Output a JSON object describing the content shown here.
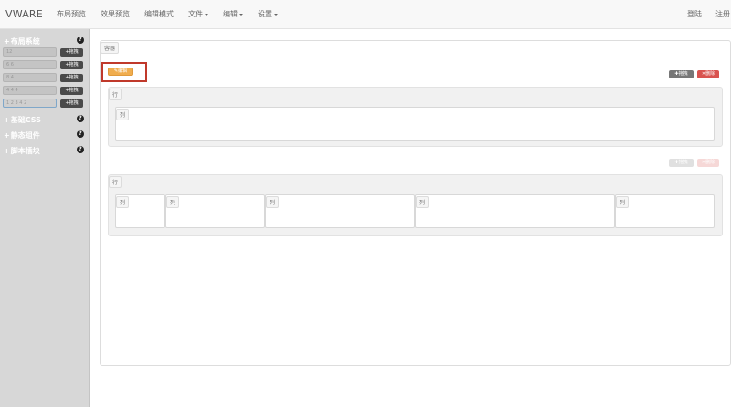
{
  "navbar": {
    "brand": "VWARE",
    "items": [
      "布局预览",
      "效果预览",
      "编辑模式",
      "文件",
      "编辑",
      "设置"
    ],
    "login": "登陆",
    "register": "注册"
  },
  "sidebar": {
    "sections": [
      {
        "label": "布局系统",
        "help": "?"
      },
      {
        "label": "基础CSS",
        "help": "?"
      },
      {
        "label": "静态组件",
        "help": "?"
      },
      {
        "label": "脚本插块",
        "help": "?"
      }
    ],
    "grid_rows": [
      "12",
      "6 6",
      "8 4",
      "4 4 4",
      "1 2 3 4 2"
    ],
    "drag_label": "拖拽",
    "plus": "+"
  },
  "canvas": {
    "container_label": "容器",
    "edit_label": "编辑",
    "drag_label": "拖拽",
    "delete_label": "删除",
    "row_label": "行",
    "col_label": "列"
  }
}
